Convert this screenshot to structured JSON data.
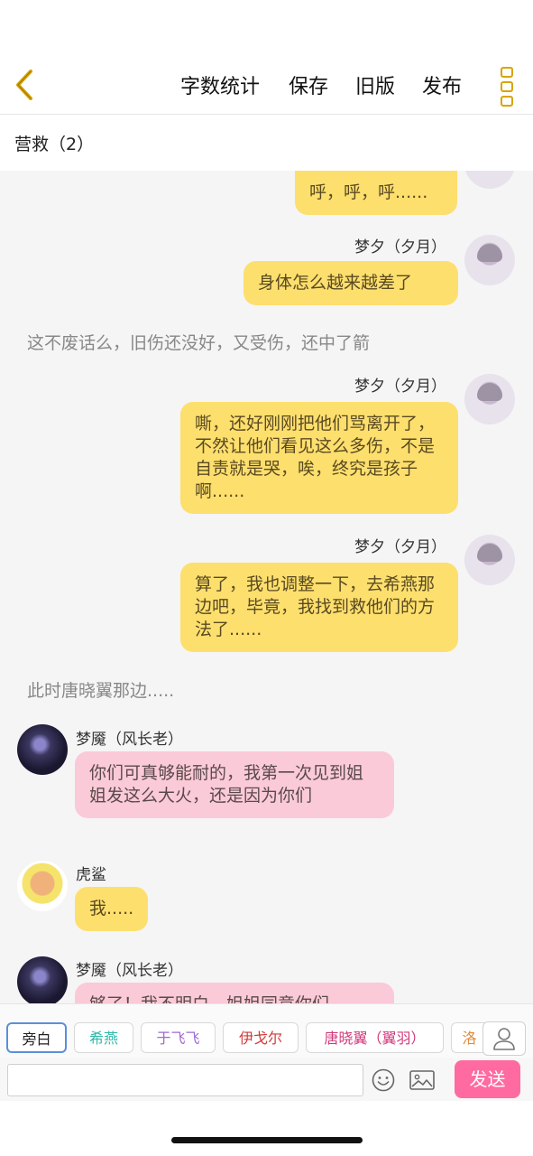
{
  "header": {
    "word_count_label": "字数统计",
    "save_label": "保存",
    "old_version_label": "旧版",
    "publish_label": "发布"
  },
  "chapter": {
    "title": "营救（2）"
  },
  "messages": {
    "m0_text": "呼，呼，呼......",
    "m1_name": "梦夕（夕月）",
    "m1_text": "身体怎么越来越差了",
    "n1_text": "这不废话么，旧伤还没好，又受伤，还中了箭",
    "m2_name": "梦夕（夕月）",
    "m2_text": "嘶，还好刚刚把他们骂离开了，不然让他们看见这么多伤，不是自责就是哭，唉，终究是孩子啊......",
    "m3_name": "梦夕（夕月）",
    "m3_text": "算了，我也调整一下，去希燕那边吧，毕竟，我找到救他们的方法了......",
    "n2_text": "此时唐晓翼那边.....",
    "m4_name": "梦魇（风长老）",
    "m4_text": "你们可真够能耐的，我第一次见到姐姐发这么大火，还是因为你们",
    "m5_name": "虎鲨",
    "m5_text": "我.....",
    "m6_name": "梦魇（风长老）",
    "m6_text": "够了！我不明白，姐姐同意你们"
  },
  "characters": {
    "narrator": "旁白",
    "c1": "希燕",
    "c2": "于飞飞",
    "c3": "伊戈尔",
    "c4": "唐晓翼（翼羽）",
    "c5": "洛"
  },
  "input": {
    "placeholder": "",
    "send_label": "发送"
  },
  "colors": {
    "accent": "#d9a400",
    "yellow_bubble": "#fddf6e",
    "pink_bubble": "#fbcad8",
    "send_button": "#ff6aa0",
    "chip_xiyan": "#2fb8a8",
    "chip_yufeifei": "#a06ad0",
    "chip_yigeer": "#d03a3a",
    "chip_tangxiaoyi": "#d03a7a",
    "chip_luo": "#e08a3a"
  },
  "icons": {
    "back": "chevron-left-icon",
    "more": "more-icon",
    "person": "person-icon",
    "emoji": "emoji-icon",
    "image": "image-icon"
  }
}
